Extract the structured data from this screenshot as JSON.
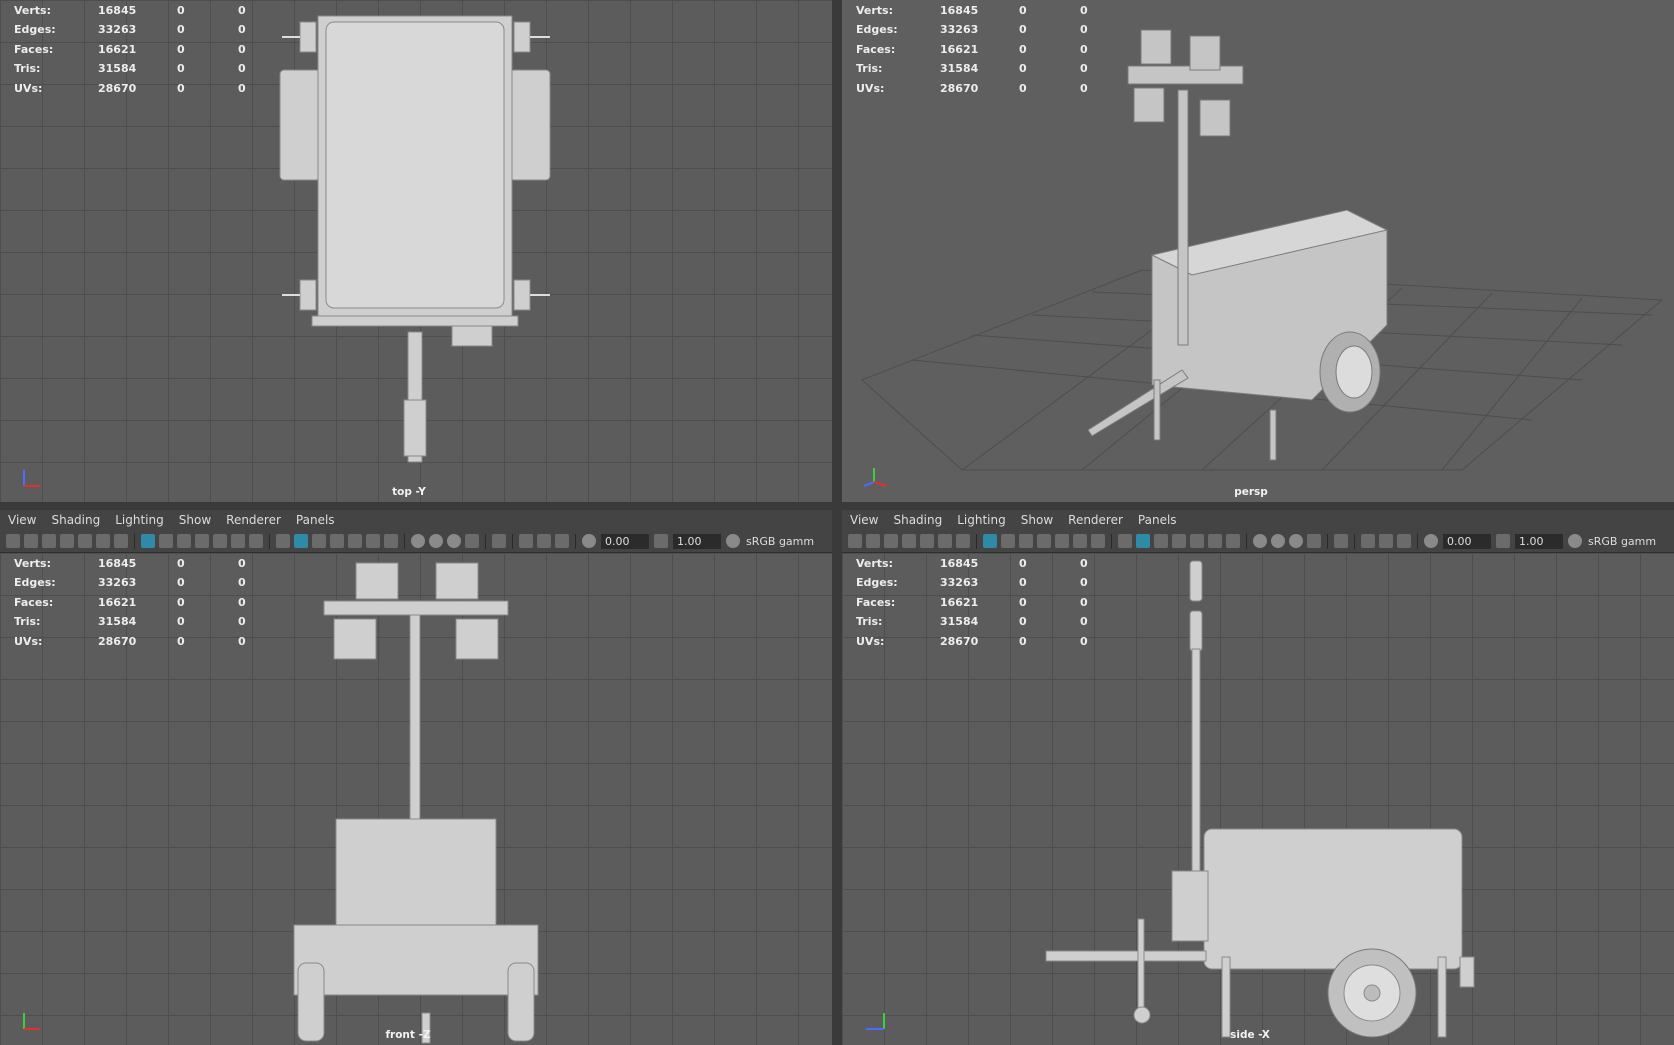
{
  "menu": [
    "View",
    "Shading",
    "Lighting",
    "Show",
    "Renderer",
    "Panels"
  ],
  "toolbar": {
    "exposure": "0.00",
    "gamma": "1.00",
    "colorspace": "sRGB gamm"
  },
  "hud": {
    "labels": [
      "Verts:",
      "Edges:",
      "Faces:",
      "Tris:",
      "UVs:"
    ],
    "rows": [
      {
        "label": "Verts:",
        "value": "16845",
        "sel": "0",
        "comp": "0"
      },
      {
        "label": "Edges:",
        "value": "33263",
        "sel": "0",
        "comp": "0"
      },
      {
        "label": "Faces:",
        "value": "16621",
        "sel": "0",
        "comp": "0"
      },
      {
        "label": "Tris:",
        "value": "31584",
        "sel": "0",
        "comp": "0"
      },
      {
        "label": "UVs:",
        "value": "28670",
        "sel": "0",
        "comp": "0"
      }
    ]
  },
  "viewports": {
    "top": {
      "camera": "top -Y"
    },
    "persp": {
      "camera": "persp"
    },
    "front": {
      "camera": "front -Z"
    },
    "side": {
      "camera": "side -X"
    }
  },
  "icons": [
    "camera-icon",
    "lock-icon",
    "bookmark-icon",
    "grid-icon",
    "wireframe-icon",
    "smooth-shade-icon",
    "light-icon",
    "isolate-icon",
    "exposure-icon",
    "gamma-icon",
    "colorspace-icon"
  ],
  "colors": {
    "viewport": "#5c5c5c",
    "grid": "#4e4e4e",
    "panel": "#444444",
    "model": "#cfcfcf",
    "active": "#2f8aa8"
  }
}
